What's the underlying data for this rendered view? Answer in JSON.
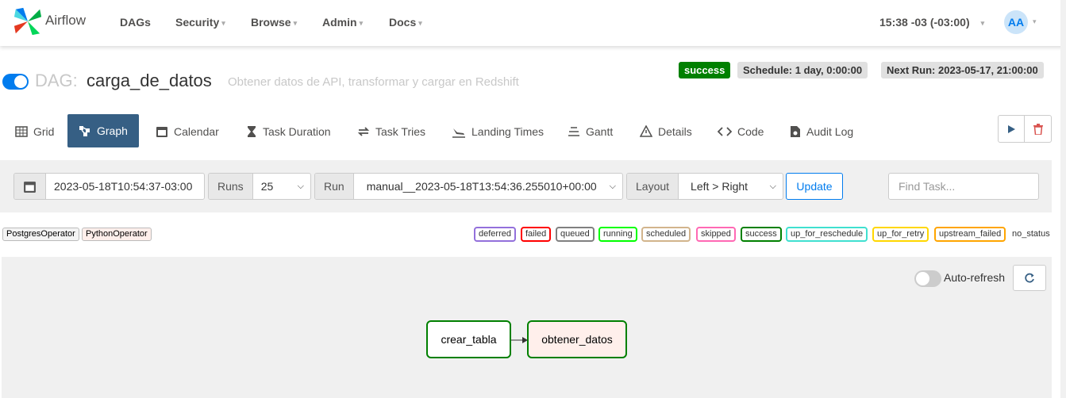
{
  "navbar": {
    "brand": "Airflow",
    "items": [
      {
        "label": "DAGs",
        "has_caret": false
      },
      {
        "label": "Security",
        "has_caret": true
      },
      {
        "label": "Browse",
        "has_caret": true
      },
      {
        "label": "Admin",
        "has_caret": true
      },
      {
        "label": "Docs",
        "has_caret": true
      }
    ],
    "time": "15:38 -03 (-03:00)",
    "avatar": "AA",
    "caret": "▾"
  },
  "dag": {
    "prefix": "DAG:",
    "name": "carga_de_datos",
    "description": "Obtener datos de API, transformar y cargar en Redshift",
    "paused": false,
    "status": "success",
    "schedule": "Schedule: 1 day, 0:00:00",
    "next_run": "Next Run: 2023-05-17, 21:00:00"
  },
  "tabs": [
    {
      "label": "Grid",
      "icon": "grid-icon"
    },
    {
      "label": "Graph",
      "icon": "graph-icon",
      "active": true
    },
    {
      "label": "Calendar",
      "icon": "calendar-icon"
    },
    {
      "label": "Task Duration",
      "icon": "hourglass-icon"
    },
    {
      "label": "Task Tries",
      "icon": "retry-icon"
    },
    {
      "label": "Landing Times",
      "icon": "landing-icon"
    },
    {
      "label": "Gantt",
      "icon": "gantt-icon"
    },
    {
      "label": "Details",
      "icon": "warning-icon"
    },
    {
      "label": "Code",
      "icon": "code-icon"
    },
    {
      "label": "Audit Log",
      "icon": "audit-icon"
    }
  ],
  "filters": {
    "base_date": "2023-05-18T10:54:37-03:00",
    "runs_label": "Runs",
    "runs_value": "25",
    "run_label": "Run",
    "run_value": "manual__2023-05-18T13:54:36.255010+00:00",
    "layout_label": "Layout",
    "layout_value": "Left > Right",
    "update_label": "Update",
    "find_placeholder": "Find Task..."
  },
  "operators": [
    "PostgresOperator",
    "PythonOperator"
  ],
  "legend": [
    {
      "label": "deferred",
      "color": "#9370db"
    },
    {
      "label": "failed",
      "color": "#ff0000"
    },
    {
      "label": "queued",
      "color": "#808080"
    },
    {
      "label": "running",
      "color": "#00ff00"
    },
    {
      "label": "scheduled",
      "color": "#d2b48c"
    },
    {
      "label": "skipped",
      "color": "#ff69b4"
    },
    {
      "label": "success",
      "color": "#008000"
    },
    {
      "label": "up_for_reschedule",
      "color": "#40e0d0"
    },
    {
      "label": "up_for_retry",
      "color": "#ffd700"
    },
    {
      "label": "upstream_failed",
      "color": "#ffa500"
    }
  ],
  "no_status": "no_status",
  "graph": {
    "auto_refresh_label": "Auto-refresh",
    "auto_refresh_on": false,
    "nodes": [
      {
        "id": "crear_tabla",
        "label": "crear_tabla",
        "operator": "PostgresOperator",
        "state": "success"
      },
      {
        "id": "obtener_datos",
        "label": "obtener_datos",
        "operator": "PythonOperator",
        "state": "success"
      }
    ],
    "edges": [
      [
        "crear_tabla",
        "obtener_datos"
      ]
    ]
  },
  "colors": {
    "accent": "#017cee",
    "active_tab": "#365f84",
    "success": "#008000",
    "python_operator_fill": "#ffefeb"
  }
}
